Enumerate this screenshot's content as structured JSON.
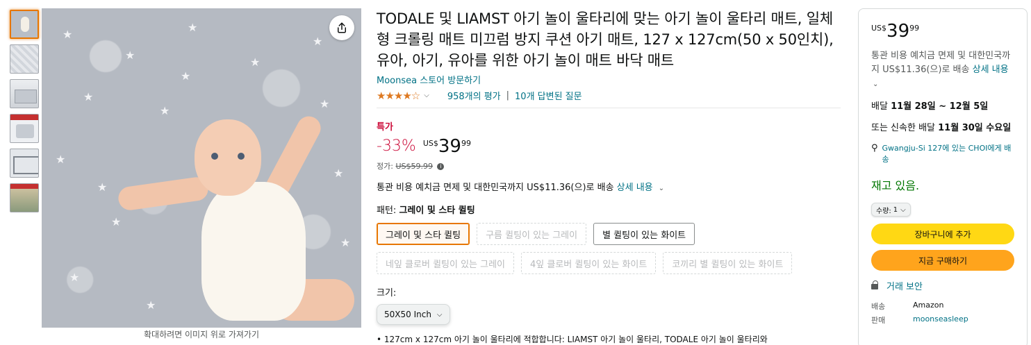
{
  "hover_hint": "확대하려면 이미지 위로 가져가기",
  "product": {
    "title": "TODALE 및 LIAMST 아기 놀이 울타리에 맞는 아기 놀이 울타리 매트, 일체형 크롤링 매트 미끄럼 방지 쿠션 아기 매트, 127 x 127cm(50 x 50인치), 유아, 아기, 유아를 위한 아기 놀이 매트 바닥 매트",
    "store_link": "Moonsea 스토어 방문하기",
    "stars": "★★★★☆",
    "ratings_count": "958개의 평가",
    "answered_questions": "10개 답변된 질문",
    "deal_label": "특가",
    "discount": "-33%",
    "price_currency": "US$",
    "price_whole": "39",
    "price_fraction": "99",
    "list_price_label": "정가:",
    "list_price": "US$59.99",
    "shipping_text": "통관 비용 예치금 면제 및 대한민국까지 US$11.36(으)로 배송",
    "shipping_detail_link": "상세 내용",
    "pattern_label": "패턴:",
    "pattern_value": "그레이 및 스타 퀼팅",
    "patterns": [
      {
        "label": "그레이 및 스타 퀼팅",
        "state": "selected"
      },
      {
        "label": "구름 퀼팅이 있는 그레이",
        "state": "dim"
      },
      {
        "label": "별 퀼팅이 있는 화이트",
        "state": "normal"
      },
      {
        "label": "네잎 클로버 퀼팅이 있는 그레이",
        "state": "dim"
      },
      {
        "label": "4잎 클로버 퀼팅이 있는 화이트",
        "state": "dim"
      },
      {
        "label": "코끼리 별 퀼팅이 있는 화이트",
        "state": "dim"
      }
    ],
    "size_label": "크기:",
    "size_value": "50X50 Inch",
    "bullet": "127cm x 127cm 아기 놀이 울타리에 적합합니다: LIAMST 아기 놀이 울타리, TODALE 아기 놀이 울타리와"
  },
  "buybox": {
    "price_currency": "US$",
    "price_whole": "39",
    "price_fraction": "99",
    "shipping_text": "통관 비용 예치금 면제 및 대한민국까지 US$11.36(으)로 배송",
    "shipping_detail_link": "상세 내용",
    "delivery_prefix": "배달",
    "delivery_dates": "11월 28일 ~ 12월 5일",
    "fast_prefix": "또는 신속한 배달",
    "fast_date": "11월 30일 수요일",
    "location": "Gwangju-Si 127에 있는 CHOI에게 배송",
    "stock": "재고 있음.",
    "qty_label": "수량:",
    "qty_value": "1",
    "add_to_cart": "장바구니에 추가",
    "buy_now": "지금 구매하기",
    "secure": "거래 보안",
    "ships_from_label": "배송",
    "ships_from": "Amazon",
    "sold_by_label": "판매",
    "sold_by": "moonseasleep"
  },
  "colors": {
    "accent_orange": "#e77600",
    "deal_red": "#cc0c39",
    "link": "#007185",
    "stock_green": "#007600",
    "cart_yellow": "#ffd814",
    "buy_orange": "#ffa41c"
  },
  "icons": {
    "share": "share-icon",
    "info": "info-icon",
    "location": "location-pin-icon",
    "lock": "lock-icon",
    "chevron": "chevron-down-icon"
  }
}
